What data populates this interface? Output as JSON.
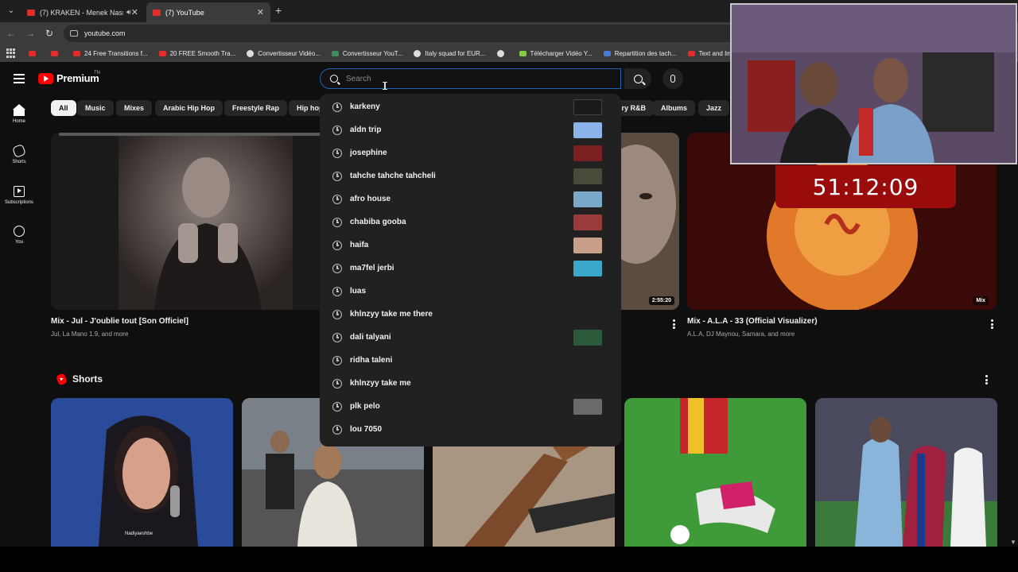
{
  "browser": {
    "tabs": [
      {
        "label": "(7) KRAKEN - Menek Nasmi"
      },
      {
        "label": "(7) YouTube"
      }
    ],
    "url": "youtube.com",
    "bookmarks": [
      {
        "label": "24 Free Transitions f..."
      },
      {
        "label": "20 FREE Smooth Tra..."
      },
      {
        "label": "Convertisseur Vidéo..."
      },
      {
        "label": "Convertisseur YouT..."
      },
      {
        "label": "Italy squad for EUR..."
      },
      {
        "label": "Télécharger Vidéo Y..."
      },
      {
        "label": "Repartition des tach..."
      },
      {
        "label": "Text and Image ani..."
      }
    ]
  },
  "masthead": {
    "logo_text": "Premium",
    "logo_tm": "TN",
    "search_placeholder": "Search"
  },
  "leftnav": [
    {
      "label": "Home"
    },
    {
      "label": "Shorts"
    },
    {
      "label": "Subscriptions"
    },
    {
      "label": "You"
    }
  ],
  "chips": [
    "All",
    "Music",
    "Mixes",
    "Arabic Hip Hop",
    "Freestyle Rap",
    "Hip hop",
    "ry R&B",
    "Albums",
    "Jazz"
  ],
  "videos": [
    {
      "title": "Mix - Jul - J'oublie tout [Son Officiel]",
      "meta": "Jul, La Mano 1.9, and more"
    },
    {
      "title": "Mix - A.L.A - 33 (Official Visualizer)",
      "meta": "A.L.A, DJ Maynou, Samara, and more",
      "badge": "Mix"
    },
    {
      "badge": "2:55:20"
    }
  ],
  "shorts": {
    "heading": "Shorts",
    "watermark": "Nadiyaeshbe"
  },
  "suggestions": [
    "karkeny",
    "aldn trip",
    "josephine",
    "tahche tahche tahcheli",
    "afro house",
    "chabiba gooba",
    "haifa",
    "ma7fel jerbi",
    "luas",
    "khlnzyy take me there",
    "dali talyani",
    "ridha taleni",
    "khlnzyy take me",
    "plk pelo",
    "lou 7050"
  ],
  "overlay": {
    "timer": "51:12:09"
  },
  "colors": {
    "background": "#0f0f0f",
    "youtube_red": "#ff0000",
    "search_focus": "#1c62b9",
    "timer_bg": "#9a0c0c"
  }
}
